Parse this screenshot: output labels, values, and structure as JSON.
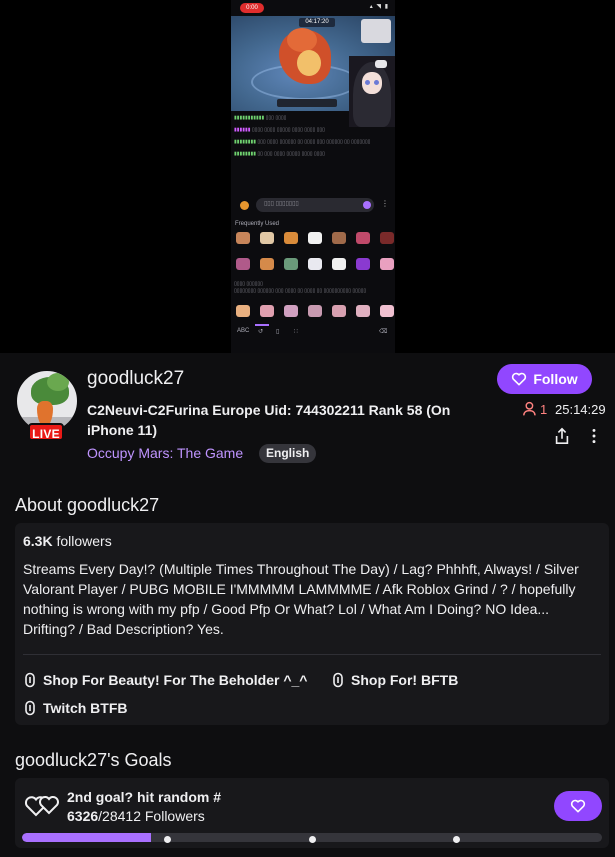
{
  "video": {
    "rec_label": "0:00",
    "game_timer": "04:17:20",
    "keyboard_label": "Frequently Used"
  },
  "channel": {
    "name": "goodluck27",
    "live_label": "LIVE",
    "title": "C2Neuvi-C2Furina Europe Uid: 744302211 Rank 58 (On iPhone 11)",
    "game": "Occupy Mars: The Game",
    "tag": "English",
    "follow_label": "Follow",
    "viewers": "1",
    "uptime": "25:14:29",
    "colors": {
      "accent": "#9147ff",
      "live": "#e91916",
      "viewer": "#ff8280",
      "link": "#bf94ff"
    }
  },
  "about": {
    "title": "About goodluck27",
    "followers_count": "6.3K",
    "followers_label": "followers",
    "bio": "Streams Every Day!? (Multiple Times Throughout The Day) / Lag? Phhhft, Always! / Silver Valorant Player / PUBG MOBILE I'MMMMM LAMMMME / Afk Roblox Grind / ? / hopefully nothing is wrong with my pfp / Good Pfp Or What? Lol / What Am I Doing? NO Idea... Drifting? / Bad Description? Yes.",
    "links": [
      {
        "label": "Shop For Beauty! For The Beholder ^_^"
      },
      {
        "label": "Shop For! BFTB"
      },
      {
        "label": "Twitch BTFB"
      }
    ]
  },
  "goals": {
    "title": "goodluck27's Goals",
    "goal_name": "2nd goal? hit random #",
    "current": "6326",
    "target_text": "/28412 Followers",
    "progress_fraction": 0.2227
  }
}
